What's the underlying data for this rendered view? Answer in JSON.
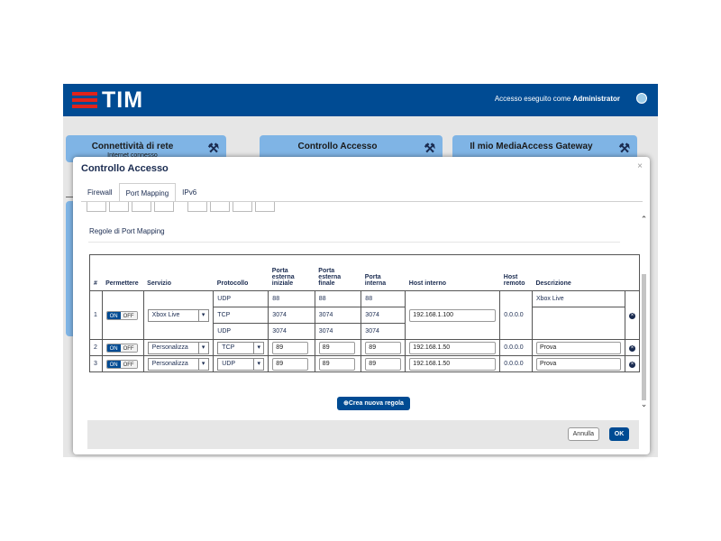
{
  "header": {
    "brand": "TIM",
    "login_prefix": "Accesso eseguito come",
    "login_user": "Administrator"
  },
  "cards": [
    {
      "title": "Connettività di rete",
      "subtitle": "Internet connesso"
    },
    {
      "title": "Controllo Accesso",
      "subtitle": ""
    },
    {
      "title": "Il mio MediaAccess Gateway",
      "subtitle": ""
    }
  ],
  "modal": {
    "title": "Controllo Accesso",
    "close": "×",
    "tabs": [
      "Firewall",
      "Port Mapping",
      "IPv6"
    ],
    "active_tab": "Port Mapping",
    "section_title": "Regole di Port Mapping",
    "columns": [
      "#",
      "Permettere",
      "Servizio",
      "Protocollo",
      "Porta esterna iniziale",
      "Porta esterna finale",
      "Porta interna",
      "Host interno",
      "Host remoto",
      "Descrizione"
    ],
    "toggle_on": "ON",
    "toggle_off": "OFF",
    "rows": [
      {
        "num": "1",
        "service": "Xbox Live",
        "protocols": [
          "UDP",
          "TCP",
          "UDP"
        ],
        "ext_start": [
          "88",
          "3074",
          "3074"
        ],
        "ext_end": [
          "88",
          "3074",
          "3074"
        ],
        "internal": [
          "88",
          "3074",
          "3074"
        ],
        "host": "192.168.1.100",
        "remote": "0.0.0.0",
        "description": "Xbox Live"
      },
      {
        "num": "2",
        "service": "Personalizza",
        "protocol": "TCP",
        "ext_start": "89",
        "ext_end": "89",
        "internal": "89",
        "host": "192.168.1.50",
        "remote": "0.0.0.0",
        "description": "Prova"
      },
      {
        "num": "3",
        "service": "Personalizza",
        "protocol": "UDP",
        "ext_start": "89",
        "ext_end": "89",
        "internal": "89",
        "host": "192.168.1.50",
        "remote": "0.0.0.0",
        "description": "Prova"
      }
    ],
    "add_rule": "Crea nuova regola",
    "cancel": "Annulla",
    "ok": "OK"
  },
  "colors": {
    "brand_blue": "#004b93",
    "brand_red": "#e2231a",
    "card_blue": "#7fb4e5"
  }
}
